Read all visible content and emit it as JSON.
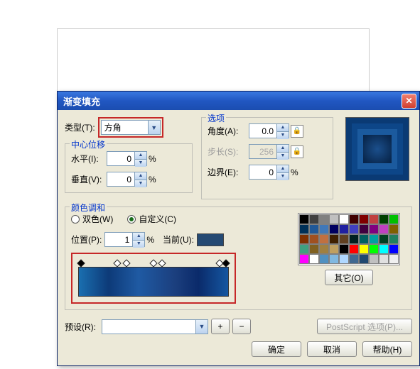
{
  "dialog": {
    "title": "渐变填充",
    "type_label": "类型(T):",
    "type_value": "方角",
    "center_offset_label": "中心位移",
    "horiz_label": "水平(I):",
    "horiz_value": "0",
    "vert_label": "垂直(V):",
    "vert_value": "0",
    "percent": "%",
    "options_label": "选项",
    "angle_label": "角度(A):",
    "angle_value": "0.0",
    "steps_label": "步长(S):",
    "steps_value": "256",
    "edgepad_label": "边界(E):",
    "edgepad_value": "0",
    "blend_label": "颜色调和",
    "radio_two": "双色(W)",
    "radio_custom": "自定义(C)",
    "pos_label": "位置(P):",
    "pos_value": "1",
    "current_label": "当前(U):",
    "current_swatch": "#254a73",
    "other_btn": "其它(O)",
    "preset_label": "预设(R):",
    "ps_options": "PostScript 选项(P)...",
    "ok": "确定",
    "cancel": "取消",
    "help": "帮助(H)"
  },
  "palette": [
    "#000000",
    "#404040",
    "#808080",
    "#c0c0c0",
    "#ffffff",
    "#400000",
    "#800000",
    "#c04040",
    "#004000",
    "#00c000",
    "#003058",
    "#205898",
    "#4078b8",
    "#000060",
    "#2020a0",
    "#4040c0",
    "#400040",
    "#800080",
    "#c040c0",
    "#806000",
    "#803000",
    "#a05020",
    "#c07040",
    "#402000",
    "#604020",
    "#002020",
    "#006060",
    "#00a0a0",
    "#004020",
    "#208060",
    "#40a080",
    "#806020",
    "#a08040",
    "#c0a060",
    "#000000",
    "#ff0000",
    "#ffff00",
    "#00ff00",
    "#00ffff",
    "#0000ff",
    "#ff00ff",
    "#ffffff",
    "#5090c0",
    "#80b8e0",
    "#b0d8ff",
    "#406890",
    "#204870",
    "#c0c0c0",
    "#e0e0e0",
    "#f0f0f0"
  ]
}
